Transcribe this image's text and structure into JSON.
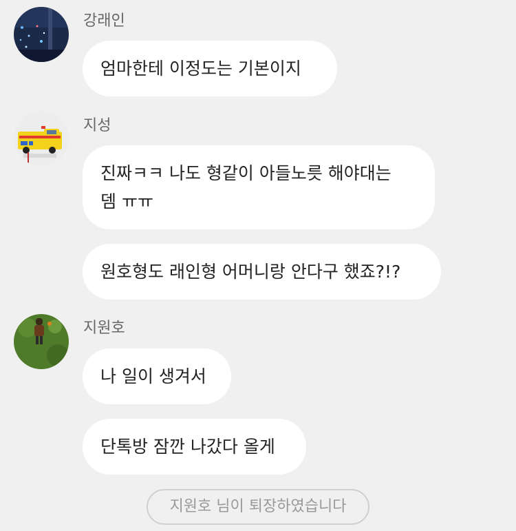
{
  "messages": [
    {
      "sender": "강래인",
      "avatar_icon": "night-city-photo-avatar",
      "bubbles": [
        "엄마한테 이정도는 기본이지"
      ]
    },
    {
      "sender": "지성",
      "avatar_icon": "ambulance-toy-avatar",
      "bubbles": [
        "진짜ㅋㅋ 나도 형같이 아들노릇 해야대는\n뎀 ㅠㅠ",
        "원호형도 래인형 어머니랑 안다구 했죠?!?"
      ]
    },
    {
      "sender": "지원호",
      "avatar_icon": "grass-figure-photo-avatar",
      "bubbles": [
        "나 일이 생겨서",
        "단톡방 잠깐 나갔다 올게"
      ]
    }
  ],
  "system_notice": "지원호 님이 퇴장하였습니다",
  "colors": {
    "background": "#f0f0f0",
    "bubble": "#ffffff",
    "sender_text": "#666666",
    "notice_border": "#cfcfcf"
  }
}
